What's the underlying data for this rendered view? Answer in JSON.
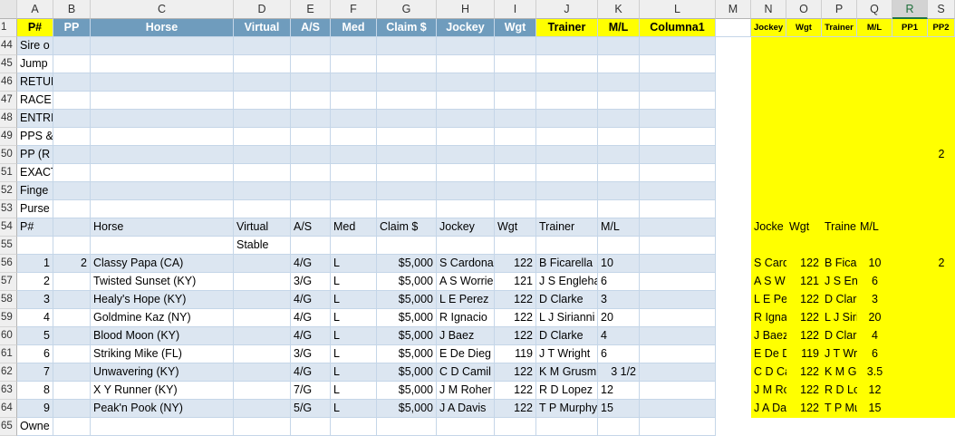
{
  "columns": [
    "A",
    "B",
    "C",
    "D",
    "E",
    "F",
    "G",
    "H",
    "I",
    "J",
    "K",
    "L",
    "M",
    "N",
    "O",
    "P",
    "Q",
    "R",
    "S"
  ],
  "selected_column": "R",
  "rows": [
    "1",
    "44",
    "45",
    "46",
    "47",
    "48",
    "49",
    "50",
    "51",
    "52",
    "53",
    "54",
    "55",
    "56",
    "57",
    "58",
    "59",
    "60",
    "61",
    "62",
    "63",
    "64",
    "65"
  ],
  "table_header": {
    "A": "P#",
    "B": "PP",
    "C": "Horse",
    "D": "Virtual",
    "E": "A/S",
    "F": "Med",
    "G": "Claim $",
    "H": "Jockey",
    "I": "Wgt",
    "J": "Trainer",
    "K": "M/L",
    "L": "Columna1",
    "N": "Jockey",
    "O": "Wgt",
    "P": "Trainer",
    "Q": "M/L",
    "R": "PP1",
    "S": "PP2"
  },
  "section_labels": [
    "Sire o",
    "Jump",
    "RETUR",
    "RACE",
    "ENTRI",
    "PPS &",
    "PP (R",
    "EXACT",
    "Finge",
    "Purse"
  ],
  "r50_s_value": "2",
  "row54": {
    "A": "P#",
    "C": "Horse",
    "D": "Virtual",
    "E": "A/S",
    "F": "Med",
    "G": "Claim $",
    "H": "Jockey",
    "I": "Wgt",
    "J": "Trainer",
    "K": "M/L",
    "N": "Jocke",
    "O": "Wgt",
    "P": "Traine",
    "Q": "M/L"
  },
  "row55": {
    "D": "Stable"
  },
  "horses": [
    {
      "pn": "1",
      "pp": "2",
      "horse": "Classy Papa (CA)",
      "as": "4/G",
      "med": "L",
      "claim": "$5,000",
      "jockey": "S Cardona",
      "wgt": "122",
      "trainer": "B Ficarella",
      "ml": "10",
      "n": "S Card",
      "o": "122",
      "p": "B Fica",
      "q": "10",
      "s": "2"
    },
    {
      "pn": "2",
      "pp": "",
      "horse": "Twisted Sunset (KY)",
      "as": "3/G",
      "med": "L",
      "claim": "$5,000",
      "jockey": "A S Worrie",
      "wgt": "121",
      "trainer": "J S Englehai",
      "ml": "6",
      "n": "A S W",
      "o": "121",
      "p": "J S Eng",
      "q": "6",
      "s": ""
    },
    {
      "pn": "3",
      "pp": "",
      "horse": "Healy's Hope (KY)",
      "as": "4/G",
      "med": "L",
      "claim": "$5,000",
      "jockey": "L E Perez",
      "wgt": "122",
      "trainer": "D Clarke",
      "ml": "3",
      "n": "L E Pe",
      "o": "122",
      "p": "D Clar",
      "q": "3",
      "s": ""
    },
    {
      "pn": "4",
      "pp": "",
      "horse": "Goldmine Kaz (NY)",
      "as": "4/G",
      "med": "L",
      "claim": "$5,000",
      "jockey": "R Ignacio",
      "wgt": "122",
      "trainer": "L J Sirianni",
      "ml": "20",
      "n": "R Igna",
      "o": "122",
      "p": "L J Siri",
      "q": "20",
      "s": ""
    },
    {
      "pn": "5",
      "pp": "",
      "horse": "Blood Moon (KY)",
      "as": "4/G",
      "med": "L",
      "claim": "$5,000",
      "jockey": "J Baez",
      "wgt": "122",
      "trainer": "D Clarke",
      "ml": "4",
      "n": "J Baez",
      "o": "122",
      "p": "D Clar",
      "q": "4",
      "s": ""
    },
    {
      "pn": "6",
      "pp": "",
      "horse": "Striking Mike (FL)",
      "as": "3/G",
      "med": "L",
      "claim": "$5,000",
      "jockey": "E De Dieg",
      "wgt": "119",
      "trainer": "J T Wright",
      "ml": "6",
      "n": "E De D",
      "o": "119",
      "p": "J T Wr",
      "q": "6",
      "s": ""
    },
    {
      "pn": "7",
      "pp": "",
      "horse": "Unwavering (KY)",
      "as": "4/G",
      "med": "L",
      "claim": "$5,000",
      "jockey": "C D Camil",
      "wgt": "122",
      "trainer": "K M Grusm",
      "ml": "3 1/2",
      "n": "C D Ca",
      "o": "122",
      "p": "K M G",
      "q": "3.5",
      "s": ""
    },
    {
      "pn": "8",
      "pp": "",
      "horse": "X Y Runner (KY)",
      "as": "7/G",
      "med": "L",
      "claim": "$5,000",
      "jockey": "J M Roher",
      "wgt": "122",
      "trainer": "R D Lopez",
      "ml": "12",
      "n": "J M Ro",
      "o": "122",
      "p": "R D Lo",
      "q": "12",
      "s": ""
    },
    {
      "pn": "9",
      "pp": "",
      "horse": "Peak'n Pook (NY)",
      "as": "5/G",
      "med": "L",
      "claim": "$5,000",
      "jockey": "J A Davis",
      "wgt": "122",
      "trainer": "T P Murphy",
      "ml": "15",
      "n": "J A Da",
      "o": "122",
      "p": "T P Mu",
      "q": "15",
      "s": ""
    }
  ],
  "row65_label": "Owne",
  "colors": {
    "header_blue": "#6f9cbd",
    "band_blue": "#dce6f1",
    "yellow": "#ffff00",
    "excel_green": "#217346"
  }
}
